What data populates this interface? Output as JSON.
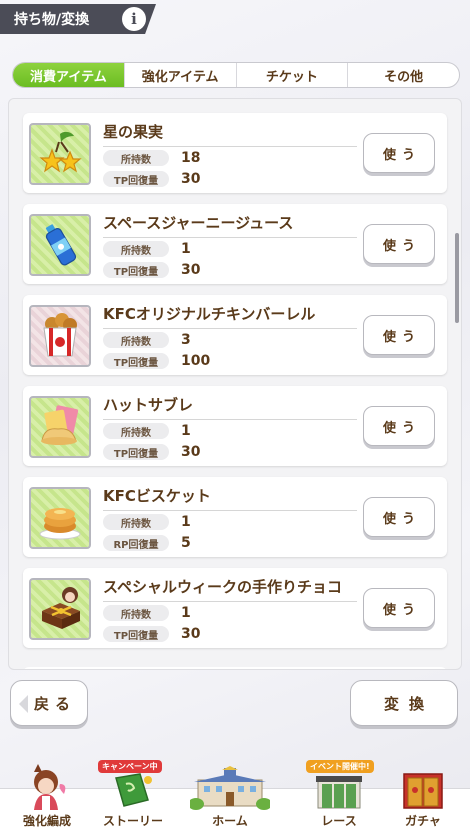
{
  "header": {
    "title": "持ち物/変換",
    "info_icon": "info-icon"
  },
  "tabs": [
    {
      "label": "消費アイテム",
      "active": true
    },
    {
      "label": "強化アイテム",
      "active": false
    },
    {
      "label": "チケット",
      "active": false
    },
    {
      "label": "その他",
      "active": false
    }
  ],
  "items": [
    {
      "name": "星の果実",
      "icon": "star-fruit-icon",
      "stat1_label": "所持数",
      "stat1_value": "18",
      "stat2_label": "TP回復量",
      "stat2_value": "30",
      "button": "使う"
    },
    {
      "name": "スペースジャーニージュース",
      "icon": "juice-bottle-icon",
      "stat1_label": "所持数",
      "stat1_value": "1",
      "stat2_label": "TP回復量",
      "stat2_value": "30",
      "button": "使う"
    },
    {
      "name": "KFCオリジナルチキンバーレル",
      "icon": "chicken-barrel-icon",
      "stat1_label": "所持数",
      "stat1_value": "3",
      "stat2_label": "TP回復量",
      "stat2_value": "100",
      "button": "使う"
    },
    {
      "name": "ハットサブレ",
      "icon": "hat-sable-icon",
      "stat1_label": "所持数",
      "stat1_value": "1",
      "stat2_label": "TP回復量",
      "stat2_value": "30",
      "button": "使う"
    },
    {
      "name": "KFCビスケット",
      "icon": "biscuit-icon",
      "stat1_label": "所持数",
      "stat1_value": "1",
      "stat2_label": "RP回復量",
      "stat2_value": "5",
      "button": "使う"
    },
    {
      "name": "スペシャルウィークの手作りチョコ",
      "icon": "chocolate-gift-icon",
      "stat1_label": "所持数",
      "stat1_value": "1",
      "stat2_label": "TP回復量",
      "stat2_value": "30",
      "button": "使う"
    }
  ],
  "footer": {
    "back_label": "戻る",
    "convert_label": "変換"
  },
  "nav": [
    {
      "label": "強化編成",
      "icon": "horse-girl-icon"
    },
    {
      "label": "ストーリー",
      "icon": "story-book-icon",
      "badge": "キャンペーン中"
    },
    {
      "label": "ホーム",
      "icon": "school-building-icon"
    },
    {
      "label": "レース",
      "icon": "race-gate-icon",
      "badge": "イベント開催中!"
    },
    {
      "label": "ガチャ",
      "icon": "gacha-door-icon"
    }
  ],
  "colors": {
    "accent_green": "#7cc72e",
    "text_brown": "#5a3a1a",
    "header_bg": "#4b4c57"
  }
}
